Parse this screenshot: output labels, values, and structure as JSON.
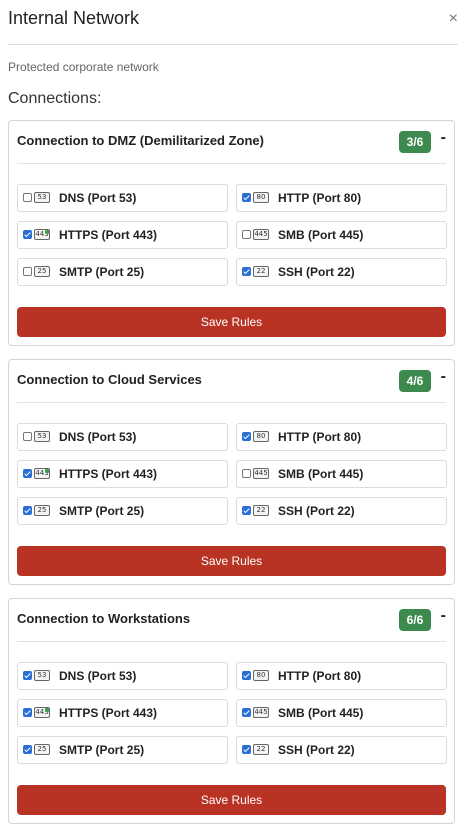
{
  "dialog": {
    "title": "Internal Network",
    "close_symbol": "×",
    "subtitle": "Protected corporate network",
    "connections_heading": "Connections:"
  },
  "colors": {
    "badge_green": "#3d8a4e",
    "save_red": "#b93325",
    "checkbox_blue": "#2a6fd6"
  },
  "connections": [
    {
      "title": "Connection to DMZ (Demilitarized Zone)",
      "badge": "3/6",
      "collapse_symbol": "-",
      "save_label": "Save Rules",
      "ports": [
        {
          "number": "53",
          "label": "DNS (Port 53)",
          "checked": false
        },
        {
          "number": "80",
          "label": "HTTP (Port 80)",
          "checked": true
        },
        {
          "number": "443",
          "label": "HTTPS (Port 443)",
          "checked": true
        },
        {
          "number": "445",
          "label": "SMB (Port 445)",
          "checked": false
        },
        {
          "number": "25",
          "label": "SMTP (Port 25)",
          "checked": false
        },
        {
          "number": "22",
          "label": "SSH (Port 22)",
          "checked": true
        }
      ]
    },
    {
      "title": "Connection to Cloud Services",
      "badge": "4/6",
      "collapse_symbol": "-",
      "save_label": "Save Rules",
      "ports": [
        {
          "number": "53",
          "label": "DNS (Port 53)",
          "checked": false
        },
        {
          "number": "80",
          "label": "HTTP (Port 80)",
          "checked": true
        },
        {
          "number": "443",
          "label": "HTTPS (Port 443)",
          "checked": true
        },
        {
          "number": "445",
          "label": "SMB (Port 445)",
          "checked": false
        },
        {
          "number": "25",
          "label": "SMTP (Port 25)",
          "checked": true
        },
        {
          "number": "22",
          "label": "SSH (Port 22)",
          "checked": true
        }
      ]
    },
    {
      "title": "Connection to Workstations",
      "badge": "6/6",
      "collapse_symbol": "-",
      "save_label": "Save Rules",
      "ports": [
        {
          "number": "53",
          "label": "DNS (Port 53)",
          "checked": true
        },
        {
          "number": "80",
          "label": "HTTP (Port 80)",
          "checked": true
        },
        {
          "number": "443",
          "label": "HTTPS (Port 443)",
          "checked": true
        },
        {
          "number": "445",
          "label": "SMB (Port 445)",
          "checked": true
        },
        {
          "number": "25",
          "label": "SMTP (Port 25)",
          "checked": true
        },
        {
          "number": "22",
          "label": "SSH (Port 22)",
          "checked": true
        }
      ]
    }
  ]
}
